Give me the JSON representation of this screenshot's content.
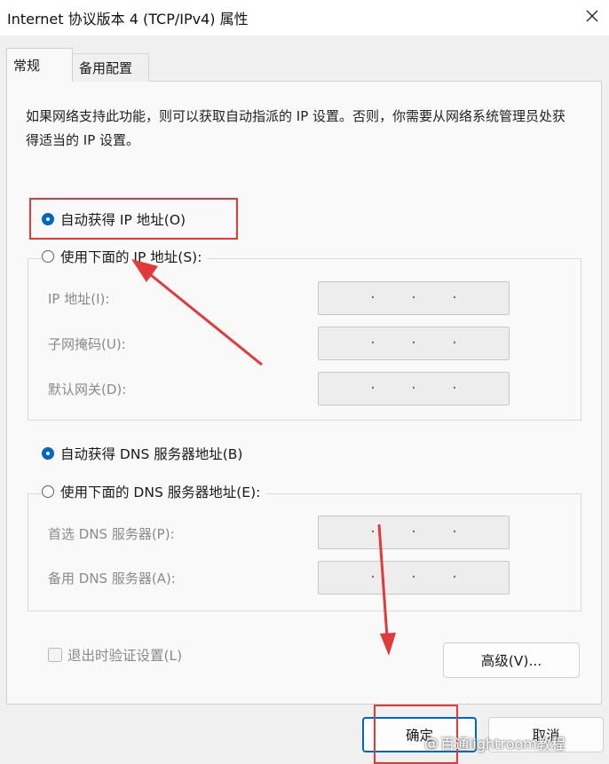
{
  "window": {
    "title": "Internet 协议版本 4 (TCP/IPv4) 属性"
  },
  "tabs": [
    {
      "label": "常规",
      "active": true
    },
    {
      "label": "备用配置",
      "active": false
    }
  ],
  "description": "如果网络支持此功能，则可以获取自动指派的 IP 设置。否则，你需要从网络系统管理员处获得适当的 IP 设置。",
  "ip": {
    "auto_label": "自动获得 IP 地址(O)",
    "auto_selected": true,
    "manual_label": "使用下面的 IP 地址(S):",
    "manual_selected": false,
    "fields": [
      {
        "label": "IP 地址(I):",
        "value": ""
      },
      {
        "label": "子网掩码(U):",
        "value": ""
      },
      {
        "label": "默认网关(D):",
        "value": ""
      }
    ]
  },
  "dns": {
    "auto_label": "自动获得 DNS 服务器地址(B)",
    "auto_selected": true,
    "manual_label": "使用下面的 DNS 服务器地址(E):",
    "manual_selected": false,
    "fields": [
      {
        "label": "首选 DNS 服务器(P):",
        "value": ""
      },
      {
        "label": "备用 DNS 服务器(A):",
        "value": ""
      }
    ]
  },
  "validate_checkbox": {
    "label": "退出时验证设置(L)",
    "checked": false
  },
  "buttons": {
    "advanced": "高级(V)...",
    "ok": "确定",
    "cancel": "取消"
  },
  "watermark": {
    "text": "百通lightroom教程"
  },
  "colors": {
    "accent": "#0067c0",
    "annotation_red": "#e03a3a"
  },
  "icons": {
    "close": "close-icon",
    "arrow": "red-arrow-annotation"
  }
}
